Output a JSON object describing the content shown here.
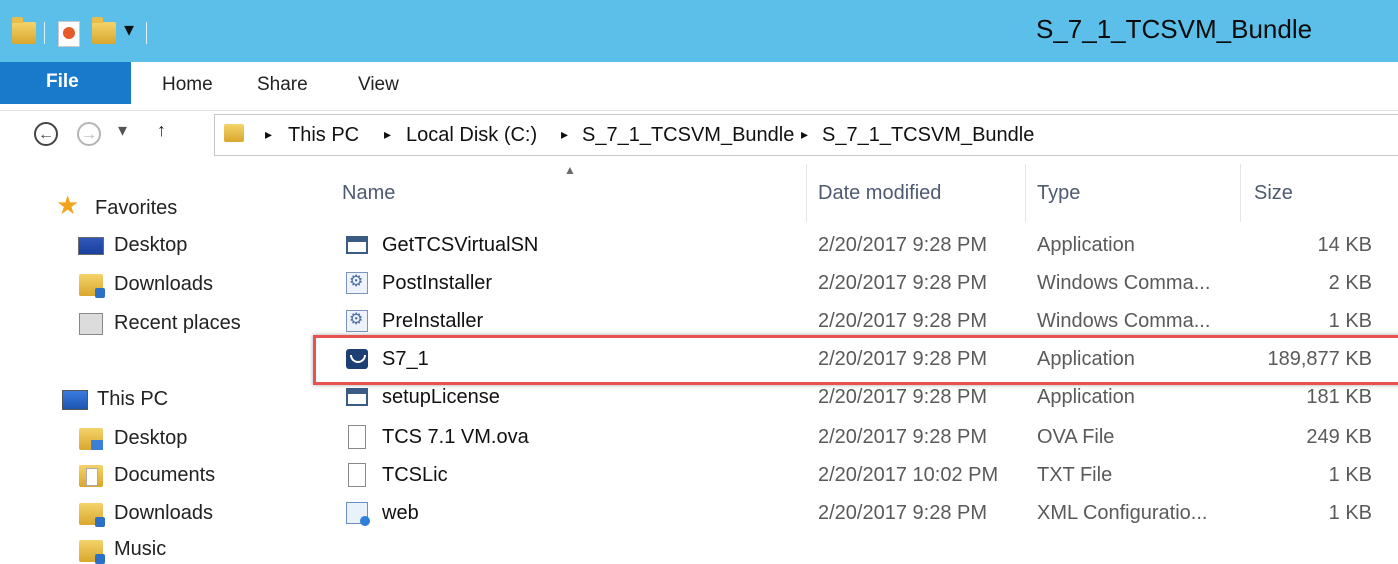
{
  "window": {
    "title": "S_7_1_TCSVM_Bundle"
  },
  "ribbon": {
    "tabs": [
      "File",
      "Home",
      "Share",
      "View"
    ]
  },
  "navigation": {
    "back": "←",
    "forward": "→",
    "recent_dropdown": "▾",
    "up": "↑",
    "breadcrumb": [
      "This PC",
      "Local Disk (C:)",
      "S_7_1_TCSVM_Bundle",
      "S_7_1_TCSVM_Bundle"
    ],
    "separator": "▸"
  },
  "sidebar": {
    "favorites": {
      "label": "Favorites",
      "items": [
        "Desktop",
        "Downloads",
        "Recent places"
      ]
    },
    "this_pc": {
      "label": "This PC",
      "items": [
        "Desktop",
        "Documents",
        "Downloads",
        "Music"
      ]
    }
  },
  "columns": {
    "name": "Name",
    "date": "Date modified",
    "type": "Type",
    "size": "Size"
  },
  "files": [
    {
      "name": "GetTCSVirtualSN",
      "date": "2/20/2017 9:28 PM",
      "type": "Application",
      "size": "14 KB",
      "icon": "application-icon"
    },
    {
      "name": "PostInstaller",
      "date": "2/20/2017 9:28 PM",
      "type": "Windows Comma...",
      "size": "2 KB",
      "icon": "script-icon"
    },
    {
      "name": "PreInstaller",
      "date": "2/20/2017 9:28 PM",
      "type": "Windows Comma...",
      "size": "1 KB",
      "icon": "script-icon"
    },
    {
      "name": "S7_1",
      "date": "2/20/2017 9:28 PM",
      "type": "Application",
      "size": "189,877 KB",
      "icon": "installer-icon",
      "highlighted": true
    },
    {
      "name": "setupLicense",
      "date": "2/20/2017 9:28 PM",
      "type": "Application",
      "size": "181 KB",
      "icon": "application-icon"
    },
    {
      "name": "TCS 7.1 VM.ova",
      "date": "2/20/2017 9:28 PM",
      "type": "OVA File",
      "size": "249 KB",
      "icon": "file-icon"
    },
    {
      "name": "TCSLic",
      "date": "2/20/2017 10:02 PM",
      "type": "TXT File",
      "size": "1 KB",
      "icon": "text-file-icon"
    },
    {
      "name": "web",
      "date": "2/20/2017 9:28 PM",
      "type": "XML Configuratio...",
      "size": "1 KB",
      "icon": "xml-config-icon"
    }
  ],
  "colors": {
    "titlebar": "#5bbfe9",
    "file_tab": "#1979ca",
    "highlight": "#e8534d"
  }
}
